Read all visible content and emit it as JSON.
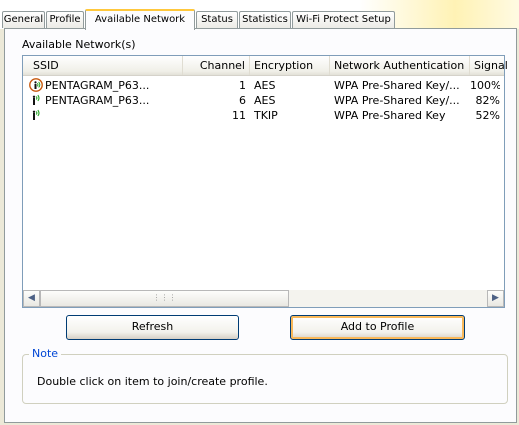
{
  "tabs": [
    {
      "label": "General"
    },
    {
      "label": "Profile"
    },
    {
      "label": "Available Network"
    },
    {
      "label": "Status"
    },
    {
      "label": "Statistics"
    },
    {
      "label": "Wi-Fi Protect Setup"
    }
  ],
  "active_tab": "Available Network",
  "section_label": "Available Network(s)",
  "columns": [
    "SSID",
    "Channel",
    "Encryption",
    "Network Authentication",
    "Signal"
  ],
  "networks": [
    {
      "ssid": "PENTAGRAM_P63...",
      "channel": "1",
      "encryption": "AES",
      "auth": "WPA Pre-Shared Key/...",
      "signal": "100%",
      "connected": true
    },
    {
      "ssid": "PENTAGRAM_P63...",
      "channel": "6",
      "encryption": "AES",
      "auth": "WPA Pre-Shared Key/...",
      "signal": "82%",
      "connected": false
    },
    {
      "ssid": "",
      "channel": "11",
      "encryption": "TKIP",
      "auth": "WPA Pre-Shared Key",
      "signal": "52%",
      "connected": false
    }
  ],
  "scroll_thumb_glyph": "⋮⋮⋮",
  "buttons": {
    "refresh": "Refresh",
    "add_to_profile": "Add to Profile"
  },
  "note": {
    "title": "Note",
    "text": "Double click on item to join/create profile."
  },
  "colors": {
    "accent_tab": "#ffc83c",
    "note_title": "#0046d5",
    "signal_green": "#1fa21f"
  }
}
